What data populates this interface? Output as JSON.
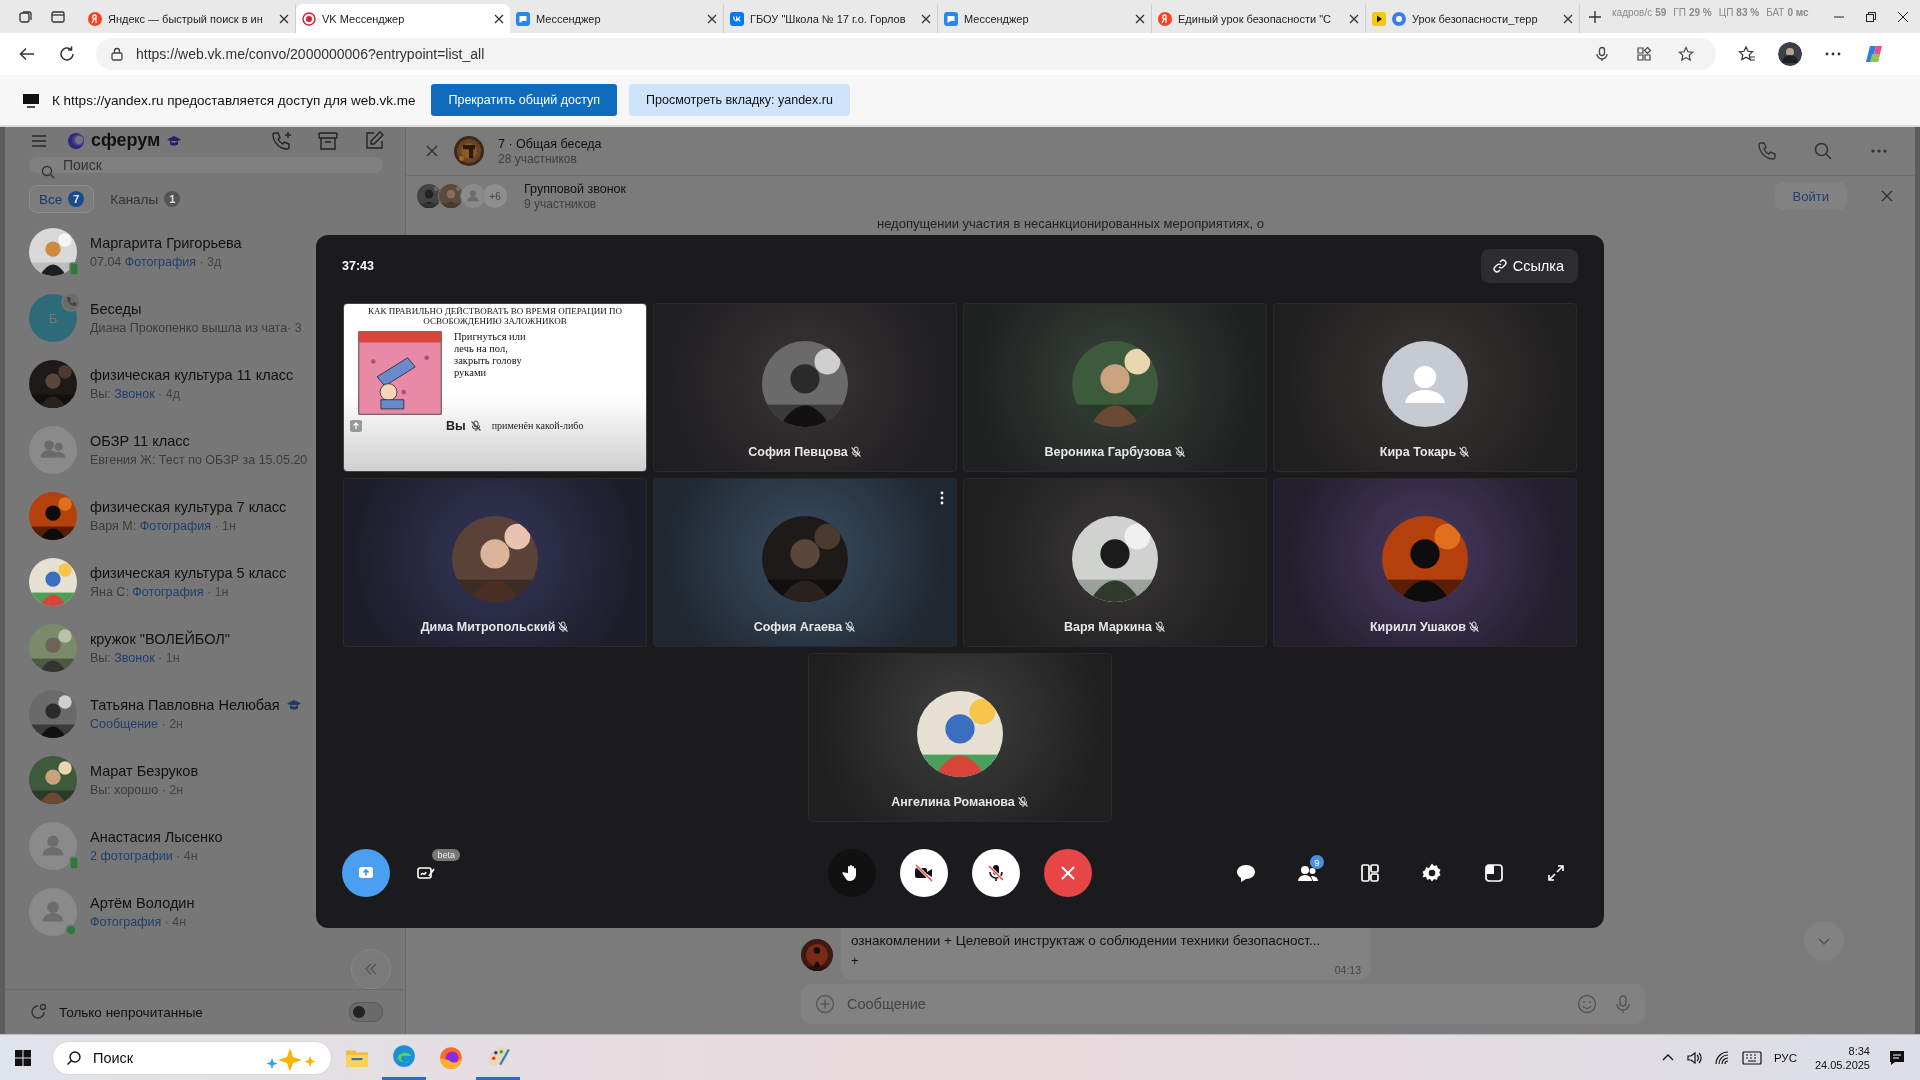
{
  "browser": {
    "tabs": [
      {
        "title": "Яндекс — быстрый поиск в ин",
        "kind": "yandex",
        "playing": false,
        "selected": false
      },
      {
        "title": "VK Мессенджер",
        "kind": "record",
        "playing": false,
        "selected": true
      },
      {
        "title": "Мессенджер",
        "kind": "chat",
        "playing": false,
        "selected": false
      },
      {
        "title": "ГБОУ \"Школа № 17 г.о. Горлов",
        "kind": "vk",
        "playing": false,
        "selected": false
      },
      {
        "title": "Мессенджер",
        "kind": "chat",
        "playing": false,
        "selected": false
      },
      {
        "title": "Единый урок безопасности \"С",
        "kind": "yandex",
        "playing": false,
        "selected": false
      },
      {
        "title": "Урок безопасности_терр",
        "kind": "circle",
        "playing": true,
        "selected": false
      }
    ],
    "stats": [
      {
        "label": "кадров/с",
        "value": "59"
      },
      {
        "label": "ГП",
        "value": "29 %"
      },
      {
        "label": "ЦП",
        "value": "83 %"
      },
      {
        "label": "БАТ",
        "value": "0 мс"
      }
    ],
    "address": "https://web.vk.me/convo/2000000006?entrypoint=list_all"
  },
  "share_bar": {
    "text": "К https://yandex.ru предоставляется доступ для web.vk.me",
    "buttons": [
      {
        "label": "Прекратить общий доступ",
        "kind": "primary"
      },
      {
        "label": "Просмотреть вкладку: yandex.ru",
        "kind": "secondary"
      }
    ]
  },
  "sidebar": {
    "logo": "сферум",
    "search_placeholder": "Поиск",
    "filters": [
      {
        "label": "Все",
        "count": "7",
        "selected": true
      },
      {
        "label": "Каналы",
        "count": "1",
        "selected": false
      }
    ],
    "chats": [
      {
        "name": "Маргарита Григорьева",
        "verified": false,
        "prefix": "07.04 ",
        "link": "Фотография",
        "time": " · 3д",
        "kind": "picture",
        "on_mobile": true,
        "online": false,
        "in_call": false
      },
      {
        "name": "Беседы",
        "verified": false,
        "prefix": "Диана Прокопенко вышла из чата",
        "time": "· 3",
        "kind": "letter",
        "letter": "Б",
        "on_mobile": false,
        "online": false,
        "in_call": true
      },
      {
        "name": "физическая культура 11 класс",
        "verified": false,
        "prefix": "Вы: ",
        "link": "Звонок",
        "time": " · 4д",
        "kind": "picture",
        "on_mobile": false,
        "online": false,
        "in_call": false
      },
      {
        "name": "ОБЗР 11 класс",
        "verified": false,
        "prefix": "Евгения Ж: Тест по ОБЗР за 15.05.20",
        "kind": "group",
        "on_mobile": false,
        "online": false,
        "in_call": false
      },
      {
        "name": "физическая культура 7 класс",
        "verified": false,
        "prefix": "Варя М: ",
        "link": "Фотография",
        "time": " · 1н",
        "kind": "picture",
        "on_mobile": false,
        "online": false,
        "in_call": false
      },
      {
        "name": "физическая культура 5 класс",
        "verified": false,
        "prefix": "Яна С: ",
        "link": "Фотография",
        "time": " · 1н",
        "kind": "picture",
        "on_mobile": false,
        "online": false,
        "in_call": false
      },
      {
        "name": "кружок \"ВОЛЕЙБОЛ\"",
        "verified": false,
        "prefix": "Вы: ",
        "link": "Звонок",
        "time": " · 1н",
        "kind": "picture",
        "on_mobile": false,
        "online": false,
        "in_call": false
      },
      {
        "name": "Татьяна Павловна Нелюбая",
        "verified": true,
        "link": "Сообщение",
        "time": " · 2н",
        "kind": "picture",
        "on_mobile": false,
        "online": false,
        "in_call": false
      },
      {
        "name": "Марат Безруков",
        "verified": false,
        "prefix": "Вы: хорошо",
        "time": " · 2н",
        "kind": "picture",
        "on_mobile": false,
        "online": false,
        "in_call": false
      },
      {
        "name": "Анастасия Лысенко",
        "verified": false,
        "link": "2 фотографии",
        "time": " · 4н",
        "kind": "placeholder",
        "on_mobile": true,
        "online": false,
        "in_call": false
      },
      {
        "name": "Артём Володин",
        "verified": false,
        "link": "Фотография",
        "time": " · 4н",
        "kind": "placeholder",
        "on_mobile": false,
        "online": true,
        "in_call": false
      }
    ],
    "footer": {
      "label": "Только непрочитанные",
      "on": false
    }
  },
  "chat": {
    "title": "7 · Общая беседа",
    "members": "28 участников",
    "call": {
      "title": "Групповой звонок",
      "members": "9 участников",
      "extra": "+6",
      "join": "Войти"
    },
    "peek_message": "недопущении участия в несанкционированных мероприятиях, о",
    "last_message": {
      "text": "ознакомлении + Целевой инструктаж о соблюдении техники безопасност...",
      "extra": "+",
      "time": "04:13"
    },
    "composer_placeholder": "Сообщение"
  },
  "call": {
    "timer": "37:43",
    "link_button": "Ссылка",
    "participants": [
      {
        "name": "Вы",
        "kind": "screen",
        "muted": true,
        "hovered": false,
        "screen": {
          "heading": "КАК ПРАВИЛЬНО ДЕЙСТВОВАТЬ ВО ВРЕМЯ ОПЕРАЦИИ ПО ОСВОБОЖДЕНИЮ ЗАЛОЖНИКОВ",
          "step": "Пригнуться или лечь на пол, закрыть голову руками",
          "next": "применён какой-либо"
        }
      },
      {
        "name": "София Певцова",
        "kind": "picture",
        "muted": true,
        "hovered": false
      },
      {
        "name": "Вероника Гарбузова",
        "kind": "picture",
        "muted": true,
        "hovered": false
      },
      {
        "name": "Кира Токарь",
        "kind": "placeholder",
        "muted": true,
        "hovered": false
      },
      {
        "name": "Дима Митропольский",
        "kind": "picture",
        "muted": true,
        "hovered": false
      },
      {
        "name": "София Агаева",
        "kind": "picture",
        "muted": true,
        "hovered": true
      },
      {
        "name": "Варя Маркина",
        "kind": "picture",
        "muted": true,
        "hovered": false
      },
      {
        "name": "Кирилл Ушаков",
        "kind": "picture",
        "muted": true,
        "hovered": false
      },
      {
        "name": "Ангелина Романова",
        "kind": "picture",
        "muted": true,
        "hovered": false
      }
    ],
    "left_controls": [
      {
        "kind": "share",
        "on": true
      },
      {
        "kind": "whiteboard",
        "on": false,
        "badge": "beta"
      }
    ],
    "center_controls": [
      {
        "kind": "hand",
        "on": false
      },
      {
        "kind": "camera",
        "on": false
      },
      {
        "kind": "mic",
        "on": false
      },
      {
        "kind": "end",
        "on": true
      }
    ],
    "right_controls": [
      {
        "kind": "chat"
      },
      {
        "kind": "participants",
        "badge": "9"
      },
      {
        "kind": "layout"
      },
      {
        "kind": "settings"
      },
      {
        "kind": "window"
      },
      {
        "kind": "fullscreen"
      }
    ]
  },
  "taskbar": {
    "search_placeholder": "Поиск",
    "language": "РУС",
    "time": "8:34",
    "date": "24.05.2025"
  }
}
